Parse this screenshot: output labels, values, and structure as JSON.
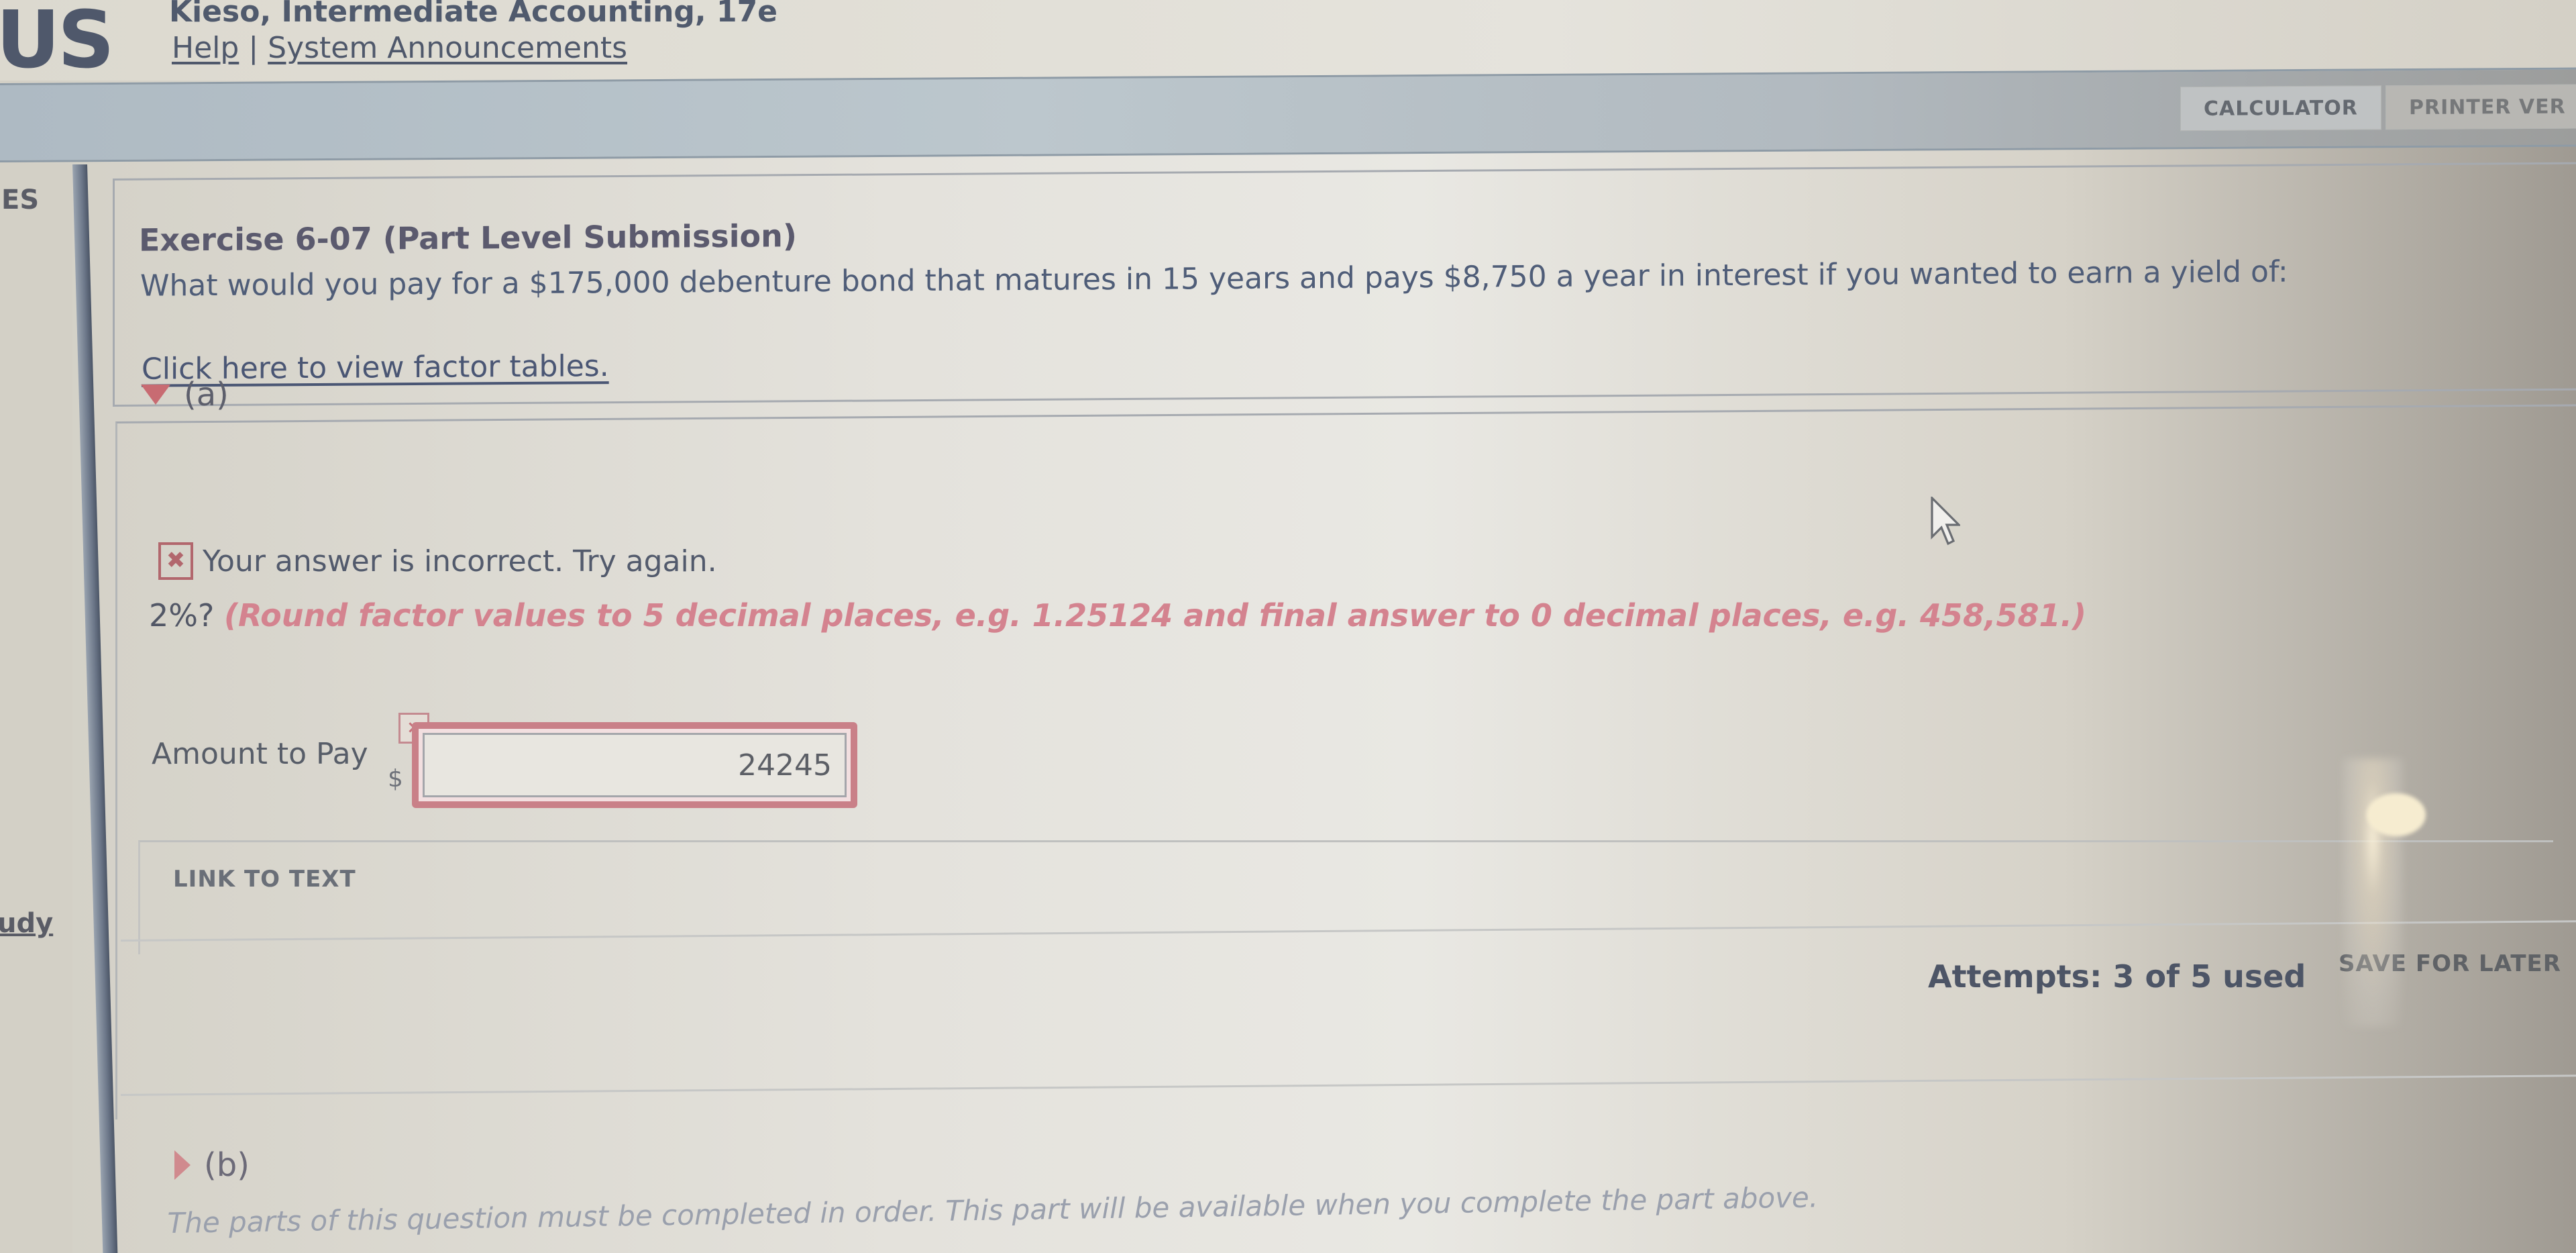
{
  "header": {
    "logo": "US",
    "course_title": "Kieso, Intermediate Accounting, 17e",
    "links": [
      {
        "label": "Help"
      },
      {
        "label": "System Announcements"
      }
    ],
    "link_separator": "|"
  },
  "toolbar": {
    "calculator_label": "CALCULATOR",
    "printer_label": "PRINTER VER"
  },
  "sidebar": {
    "items": [
      {
        "label": "ES"
      },
      {
        "label": "udy"
      }
    ]
  },
  "question": {
    "title": "Exercise 6-07 (Part Level Submission)",
    "text": "What would you pay for a $175,000 debenture bond that matures in 15 years and pays $8,750 a year in interest if you wanted to earn a yield of:",
    "factor_tables_link": "Click here to view factor tables."
  },
  "part_a": {
    "label": "(a)",
    "expanded": true,
    "feedback": {
      "icon": "x-mark-icon",
      "text": "Your answer is incorrect.  Try again."
    },
    "prompt_prefix": "2%?",
    "prompt_instruction": "(Round factor values to 5 decimal places, e.g. 1.25124 and final answer to 0 decimal places, e.g. 458,581.)",
    "field_label": "Amount to Pay",
    "currency_symbol": "$",
    "input_value": "24245",
    "input_status": "incorrect",
    "link_to_text_label": "LINK TO TEXT",
    "attempts_text": "Attempts: 3 of 5 used",
    "save_for_later_label": "SAVE FOR LATER"
  },
  "part_b": {
    "label": "(b)",
    "expanded": false,
    "note": "The parts of this question must be completed in order. This part will be available when you complete the part above."
  },
  "colors": {
    "error_accent": "#c98088",
    "instruction_pink": "#d4838f",
    "toolbar_blue": "#b6c2c9",
    "text_slate": "#4f586b"
  }
}
